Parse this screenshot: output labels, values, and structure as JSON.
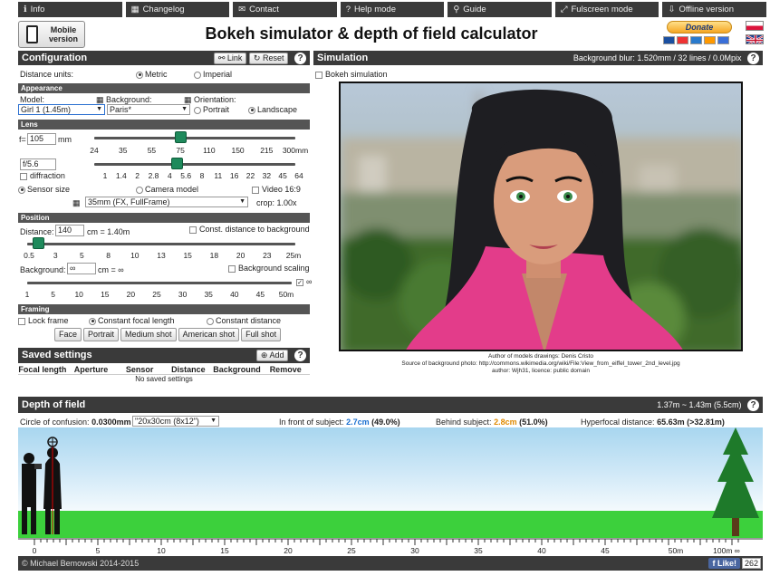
{
  "nav": [
    {
      "icon": "ℹ",
      "label": "Info"
    },
    {
      "icon": "▦",
      "label": "Changelog"
    },
    {
      "icon": "✉",
      "label": "Contact"
    },
    {
      "icon": "?",
      "label": "Help mode"
    },
    {
      "icon": "⚲",
      "label": "Guide"
    },
    {
      "icon": "⤢",
      "label": "Fulscreen mode"
    },
    {
      "icon": "⇩",
      "label": "Offline version"
    }
  ],
  "mobile_label": "Mobile version",
  "title": "Bokeh simulator & depth of field calculator",
  "donate_label": "Donate",
  "config": {
    "header": "Configuration",
    "link_label": "Link",
    "reset_label": "Reset",
    "distance_units_label": "Distance units:",
    "metric_label": "Metric",
    "imperial_label": "Imperial",
    "appearance_header": "Appearance",
    "model_label": "Model:",
    "model_value": "Girl 1 (1.45m)",
    "background_label": "Background:",
    "background_value": "Paris*",
    "orientation_label": "Orientation:",
    "portrait_label": "Portrait",
    "landscape_label": "Landscape",
    "lens_header": "Lens",
    "focal_prefix": "f=",
    "focal_value": "105",
    "focal_unit": "mm",
    "focal_ticks": [
      "24",
      "35",
      "55",
      "75",
      "110",
      "150",
      "215",
      "300mm"
    ],
    "focal_position": 0.43,
    "aperture_value": "f/5.6",
    "diffraction_label": "diffraction",
    "aperture_ticks": [
      "1",
      "1.4",
      "2",
      "2.8",
      "4",
      "5.6",
      "8",
      "11",
      "16",
      "22",
      "32",
      "45",
      "64"
    ],
    "aperture_position": 0.41,
    "sensor_size_label": "Sensor size",
    "camera_model_label": "Camera model",
    "video_label": "Video 16:9",
    "sensor_value": "35mm (FX, FullFrame)",
    "crop_label": "crop: 1.00x",
    "position_header": "Position",
    "distance_label": "Distance:",
    "distance_value": "140",
    "distance_readout": "cm = 1.40m",
    "const_distance_label": "Const. distance to background",
    "distance_ticks": [
      "0.5",
      "3",
      "5",
      "8",
      "10",
      "13",
      "15",
      "18",
      "20",
      "23",
      "25m"
    ],
    "distance_position": 0.04,
    "background_dist_label": "Background:",
    "background_dist_value": "∞",
    "background_readout": "cm = ∞",
    "bg_scaling_label": "Background scaling",
    "inf_label": "∞",
    "bg_ticks": [
      "1",
      "5",
      "10",
      "15",
      "20",
      "25",
      "30",
      "35",
      "40",
      "45",
      "50m"
    ],
    "framing_header": "Framing",
    "lock_frame_label": "Lock frame",
    "const_focal_label": "Constant focal length",
    "const_dist_label": "Constant distance",
    "frame_buttons": [
      "Face",
      "Portrait",
      "Medium shot",
      "American shot",
      "Full shot"
    ]
  },
  "saved": {
    "header": "Saved settings",
    "add_label": "Add",
    "columns": [
      "Focal length",
      "Aperture",
      "Sensor",
      "Distance",
      "Background",
      "Remove"
    ],
    "empty_text": "No saved settings"
  },
  "simulation": {
    "header": "Simulation",
    "blur_info": "Background blur: 1.520mm / 32 lines / 0.0Mpix",
    "bokeh_label": "Bokeh simulation",
    "credit_lines": [
      "Author of models drawings: Denis Cristo",
      "Source of background photo: http://commons.wikimedia.org/wiki/File:View_from_eiffel_tower_2nd_level.jpg",
      "author: Wjh31, licence: public domain"
    ]
  },
  "dof": {
    "header": "Depth of field",
    "range": "1.37m ~ 1.43m (5.5cm)",
    "coc_label": "Circle of confusion:",
    "coc_value": "0.0300mm",
    "print_value": "\"20x30cm (8x12\")",
    "front_label": "In front of subject:",
    "front_value": "2.7cm",
    "front_pct": "(49.0%)",
    "behind_label": "Behind subject:",
    "behind_value": "2.8cm",
    "behind_pct": "(51.0%)",
    "hyperfocal_label": "Hyperfocal distance:",
    "hyperfocal_value": "65.63m (>32.81m)",
    "ruler_labels": [
      "0",
      "5",
      "10",
      "15",
      "20",
      "25",
      "30",
      "35",
      "40",
      "45",
      "50m",
      "100m ∞"
    ]
  },
  "footer": {
    "copyright": "© Michael Bemowski 2014-2015",
    "like_label": "Like!",
    "like_count": "262"
  },
  "colors": {
    "front": "#1a6fd0",
    "behind": "#e08a00",
    "header": "#3a3a3a",
    "slider": "#1f8a5c"
  }
}
